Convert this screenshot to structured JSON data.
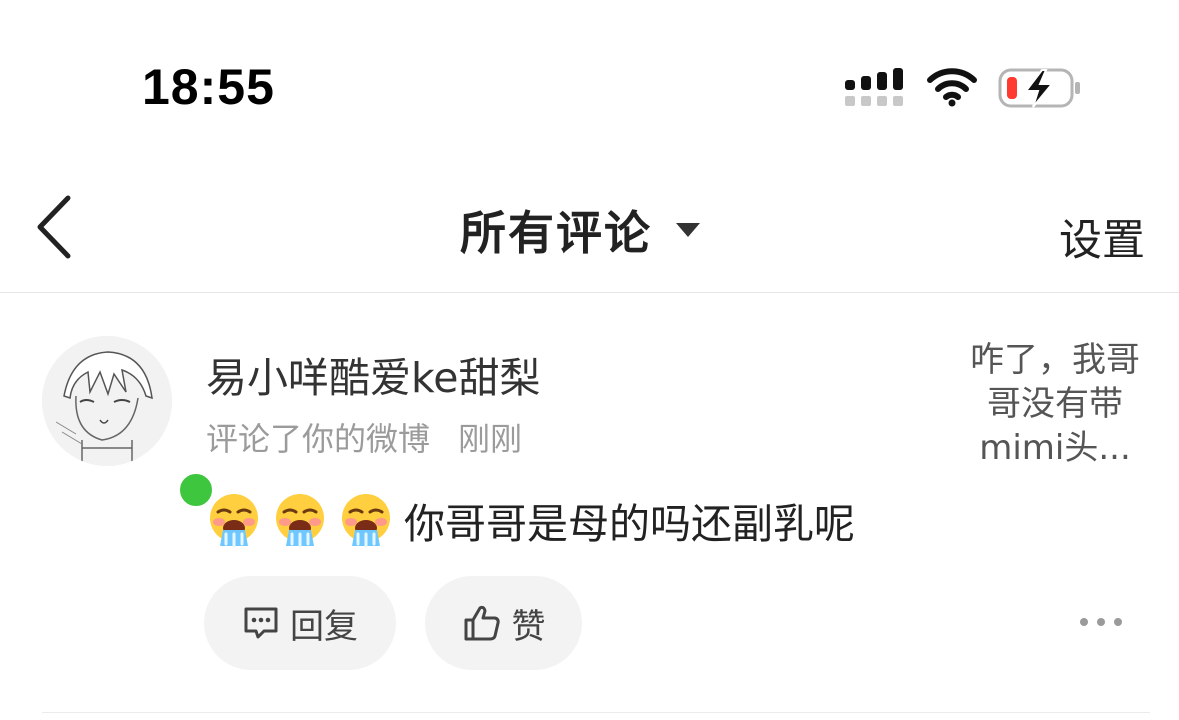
{
  "status_bar": {
    "time": "18:55",
    "battery_color": "#ff3b30"
  },
  "nav": {
    "title": "所有评论",
    "settings_label": "设置"
  },
  "comment": {
    "username": "易小咩酷爱ke甜梨",
    "action": "评论了你的微博",
    "time": "刚刚",
    "emojis": [
      "vomit-emoji",
      "vomit-emoji",
      "vomit-emoji"
    ],
    "text": "你哥哥是母的吗还副乳呢",
    "quoted_text": "咋了，我哥哥没有带mimi头...",
    "reply_label": "回复",
    "like_label": "赞",
    "online_color": "#3fc63f"
  }
}
